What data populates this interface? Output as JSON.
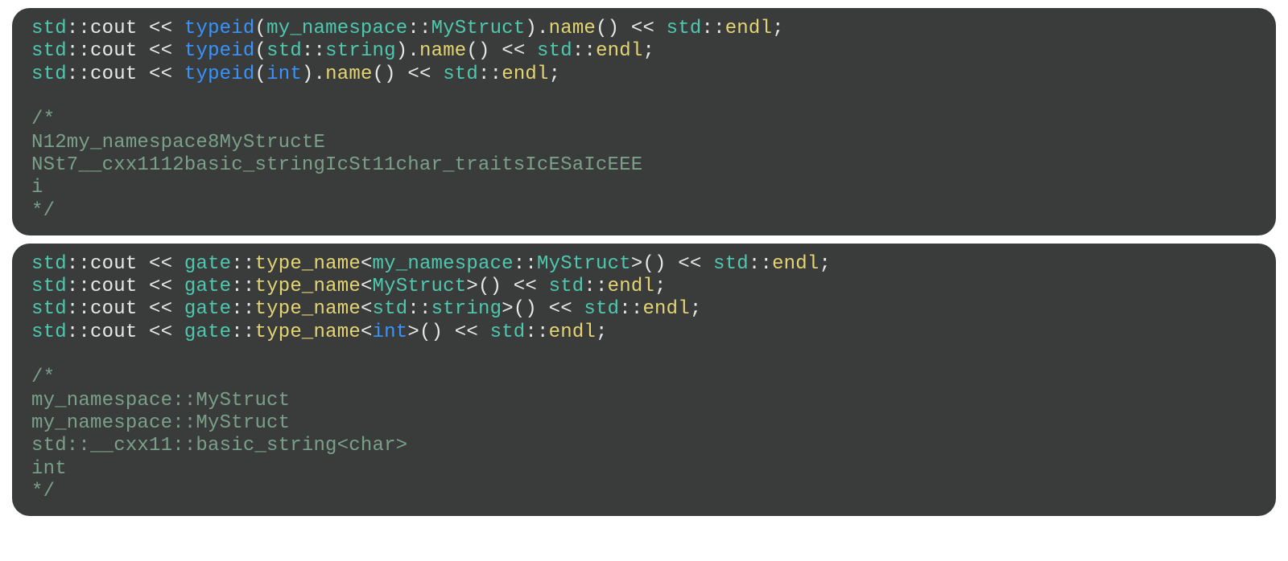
{
  "block1": {
    "line1": {
      "t1": "std",
      "t2": "::",
      "t3": "cout",
      "t4": " << ",
      "t5": "typeid",
      "t6": "(",
      "t7": "my_namespace",
      "t8": "::",
      "t9": "MyStruct",
      "t10": ").",
      "t11": "name",
      "t12": "() << ",
      "t13": "std",
      "t14": "::",
      "t15": "endl",
      "t16": ";"
    },
    "line2": {
      "t1": "std",
      "t2": "::",
      "t3": "cout",
      "t4": " << ",
      "t5": "typeid",
      "t6": "(",
      "t7": "std",
      "t8": "::",
      "t9": "string",
      "t10": ").",
      "t11": "name",
      "t12": "() << ",
      "t13": "std",
      "t14": "::",
      "t15": "endl",
      "t16": ";"
    },
    "line3": {
      "t1": "std",
      "t2": "::",
      "t3": "cout",
      "t4": " << ",
      "t5": "typeid",
      "t6": "(",
      "t7": "int",
      "t8": ").",
      "t9": "name",
      "t10": "() << ",
      "t11": "std",
      "t12": "::",
      "t13": "endl",
      "t14": ";"
    },
    "comment": "/*\nN12my_namespace8MyStructE\nNSt7__cxx1112basic_stringIcSt11char_traitsIcESaIcEEE\ni\n*/"
  },
  "block2": {
    "line1": {
      "t1": "std",
      "t2": "::",
      "t3": "cout",
      "t4": " << ",
      "t5": "gate",
      "t6": "::",
      "t7": "type_name",
      "t8": "<",
      "t9": "my_namespace",
      "t10": "::",
      "t11": "MyStruct",
      "t12": ">() << ",
      "t13": "std",
      "t14": "::",
      "t15": "endl",
      "t16": ";"
    },
    "line2": {
      "t1": "std",
      "t2": "::",
      "t3": "cout",
      "t4": " << ",
      "t5": "gate",
      "t6": "::",
      "t7": "type_name",
      "t8": "<",
      "t9": "MyStruct",
      "t10": ">() << ",
      "t11": "std",
      "t12": "::",
      "t13": "endl",
      "t14": ";"
    },
    "line3": {
      "t1": "std",
      "t2": "::",
      "t3": "cout",
      "t4": " << ",
      "t5": "gate",
      "t6": "::",
      "t7": "type_name",
      "t8": "<",
      "t9": "std",
      "t10": "::",
      "t11": "string",
      "t12": ">() << ",
      "t13": "std",
      "t14": "::",
      "t15": "endl",
      "t16": ";"
    },
    "line4": {
      "t1": "std",
      "t2": "::",
      "t3": "cout",
      "t4": " << ",
      "t5": "gate",
      "t6": "::",
      "t7": "type_name",
      "t8": "<",
      "t9": "int",
      "t10": ">() << ",
      "t11": "std",
      "t12": "::",
      "t13": "endl",
      "t14": ";"
    },
    "comment": "/*\nmy_namespace::MyStruct\nmy_namespace::MyStruct\nstd::__cxx11::basic_string<char>\nint\n*/"
  }
}
